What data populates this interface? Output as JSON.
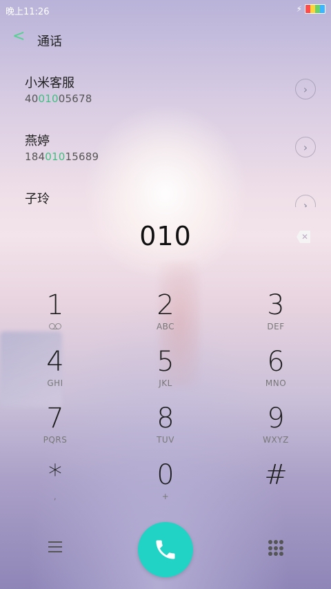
{
  "status_bar": {
    "time": "晚上11:26",
    "charging_icon": "bolt-icon",
    "battery_colors": [
      "#ff4b4b",
      "#ffd33b",
      "#6ad36a",
      "#3bb6ff"
    ]
  },
  "header": {
    "back_icon": "chevron-left-icon",
    "title": "通话",
    "accent": "#4fd38f"
  },
  "contacts": [
    {
      "name": "小米客服",
      "num_pre": "40",
      "num_match": "010",
      "num_post": "05678"
    },
    {
      "name": "燕婷",
      "num_pre": "184",
      "num_match": "010",
      "num_post": "15689"
    },
    {
      "name": "子玲",
      "num_pre": "",
      "num_match": "",
      "num_post": ""
    }
  ],
  "dial": {
    "entered": "010",
    "backspace_icon": "backspace-icon"
  },
  "keypad": [
    {
      "digit": "1",
      "letters": ""
    },
    {
      "digit": "2",
      "letters": "ABC"
    },
    {
      "digit": "3",
      "letters": "DEF"
    },
    {
      "digit": "4",
      "letters": "GHI"
    },
    {
      "digit": "5",
      "letters": "JKL"
    },
    {
      "digit": "6",
      "letters": "MNO"
    },
    {
      "digit": "7",
      "letters": "PQRS"
    },
    {
      "digit": "8",
      "letters": "TUV"
    },
    {
      "digit": "9",
      "letters": "WXYZ"
    },
    {
      "digit": "*",
      "letters": ","
    },
    {
      "digit": "0",
      "letters": "+"
    },
    {
      "digit": "#",
      "letters": ""
    }
  ],
  "bottom": {
    "menu_icon": "menu-icon",
    "call_icon": "phone-icon",
    "call_color": "#21d3c4",
    "dialpad_icon": "dialpad-icon"
  }
}
